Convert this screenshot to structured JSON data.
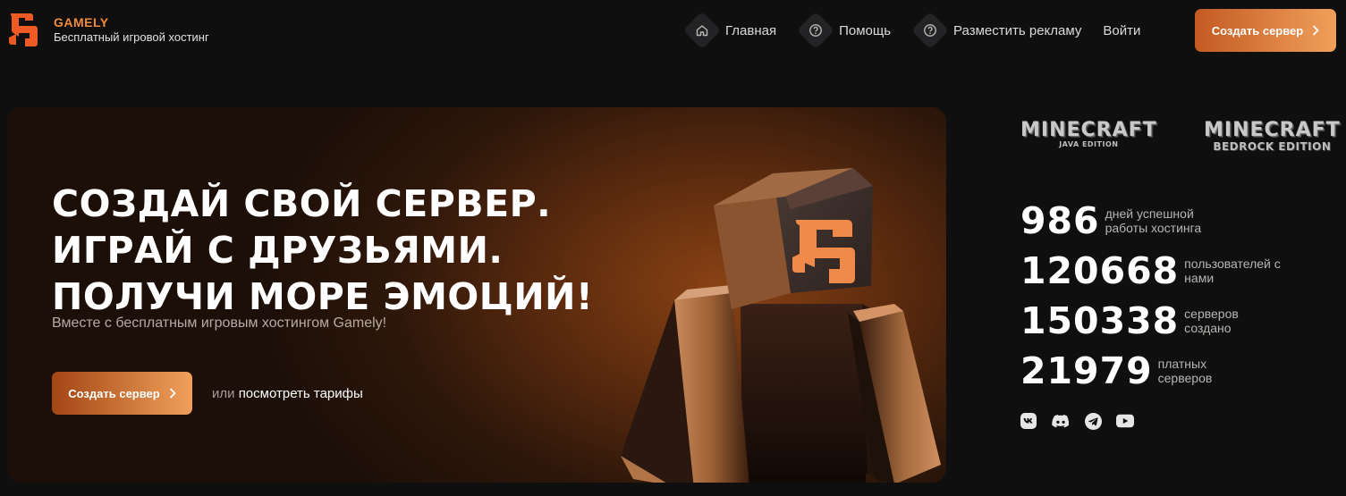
{
  "header": {
    "brand_name": "GAMELY",
    "brand_tagline": "Бесплатный игровой хостинг",
    "nav": [
      {
        "label": "Главная",
        "icon": "home-icon"
      },
      {
        "label": "Помощь",
        "icon": "help-icon"
      },
      {
        "label": "Разместить рекламу",
        "icon": "help-icon"
      }
    ],
    "login_label": "Войти",
    "create_button_label": "Создать сервер"
  },
  "hero": {
    "title": "СОЗДАЙ СВОЙ СЕРВЕР.\nИГРАЙ С ДРУЗЬЯМИ.\nПОЛУЧИ МОРЕ ЭМОЦИЙ!",
    "subtitle": "Вместе с бесплатным игровым хостингом Gamely!",
    "create_button_label": "Создать сервер",
    "or_text": "или",
    "tariffs_link": "посмотреть тарифы"
  },
  "editions": [
    {
      "word": "MINECRAFT",
      "edition": "JAVA EDITION"
    },
    {
      "word": "MINECRAFT",
      "edition": "BEDROCK EDITION"
    }
  ],
  "stats": [
    {
      "value": "986",
      "label": "дней успешной работы хостинга"
    },
    {
      "value": "120668",
      "label": "пользователей с нами"
    },
    {
      "value": "150338",
      "label": "серверов создано"
    },
    {
      "value": "21979",
      "label": "платных серверов"
    }
  ],
  "socials": [
    "vk-icon",
    "discord-icon",
    "telegram-icon",
    "youtube-icon"
  ],
  "colors": {
    "accent": "#f08a3c",
    "button_gradient_start": "#c35a22",
    "button_gradient_end": "#f0a05a",
    "background": "#0f0f10"
  }
}
